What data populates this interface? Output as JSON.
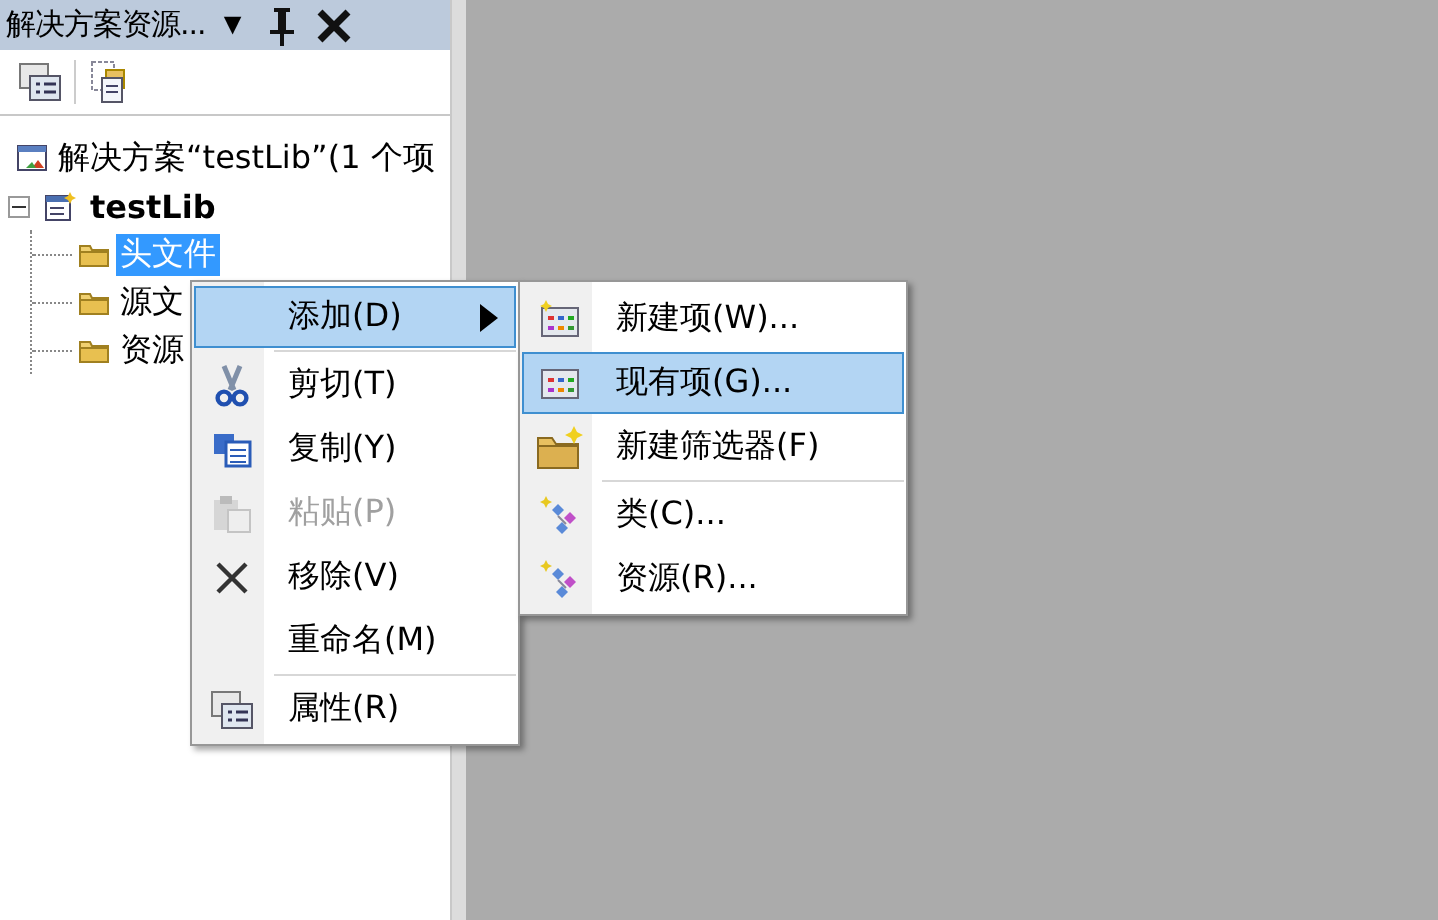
{
  "panel": {
    "title": "解决方案资源...",
    "dropdown": "▼"
  },
  "tree": [
    {
      "label": "解决方案“testLib”(1 个项",
      "kind": "solution",
      "selected": false,
      "children": [
        {
          "label": "testLib",
          "kind": "project",
          "selected": false,
          "expanded": true,
          "children": [
            {
              "label": "头文件",
              "kind": "folder",
              "selected": true
            },
            {
              "label": "源文",
              "kind": "folder",
              "selected": false
            },
            {
              "label": "资源",
              "kind": "folder",
              "selected": false
            }
          ]
        }
      ]
    }
  ],
  "context_menu": [
    {
      "kind": "item",
      "label": "添加(D)",
      "selected": true,
      "disabled": false,
      "submenu": true
    },
    {
      "kind": "separator"
    },
    {
      "kind": "item",
      "label": "剪切(T)",
      "selected": false,
      "disabled": false,
      "submenu": false
    },
    {
      "kind": "item",
      "label": "复制(Y)",
      "selected": false,
      "disabled": false,
      "submenu": false
    },
    {
      "kind": "item",
      "label": "粘贴(P)",
      "selected": false,
      "disabled": true,
      "submenu": false
    },
    {
      "kind": "item",
      "label": "移除(V)",
      "selected": false,
      "disabled": false,
      "submenu": false
    },
    {
      "kind": "item",
      "label": "重命名(M)",
      "selected": false,
      "disabled": false,
      "submenu": false
    },
    {
      "kind": "separator"
    },
    {
      "kind": "item",
      "label": "属性(R)",
      "selected": false,
      "disabled": false,
      "submenu": false
    }
  ],
  "submenu": [
    {
      "kind": "item",
      "label": "新建项(W)...",
      "selected": false,
      "disabled": false
    },
    {
      "kind": "item",
      "label": "现有项(G)...",
      "selected": true,
      "disabled": false
    },
    {
      "kind": "item",
      "label": "新建筛选器(F)",
      "selected": false,
      "disabled": false
    },
    {
      "kind": "separator"
    },
    {
      "kind": "item",
      "label": "类(C)...",
      "selected": false,
      "disabled": false
    },
    {
      "kind": "item",
      "label": "资源(R)...",
      "selected": false,
      "disabled": false
    }
  ]
}
